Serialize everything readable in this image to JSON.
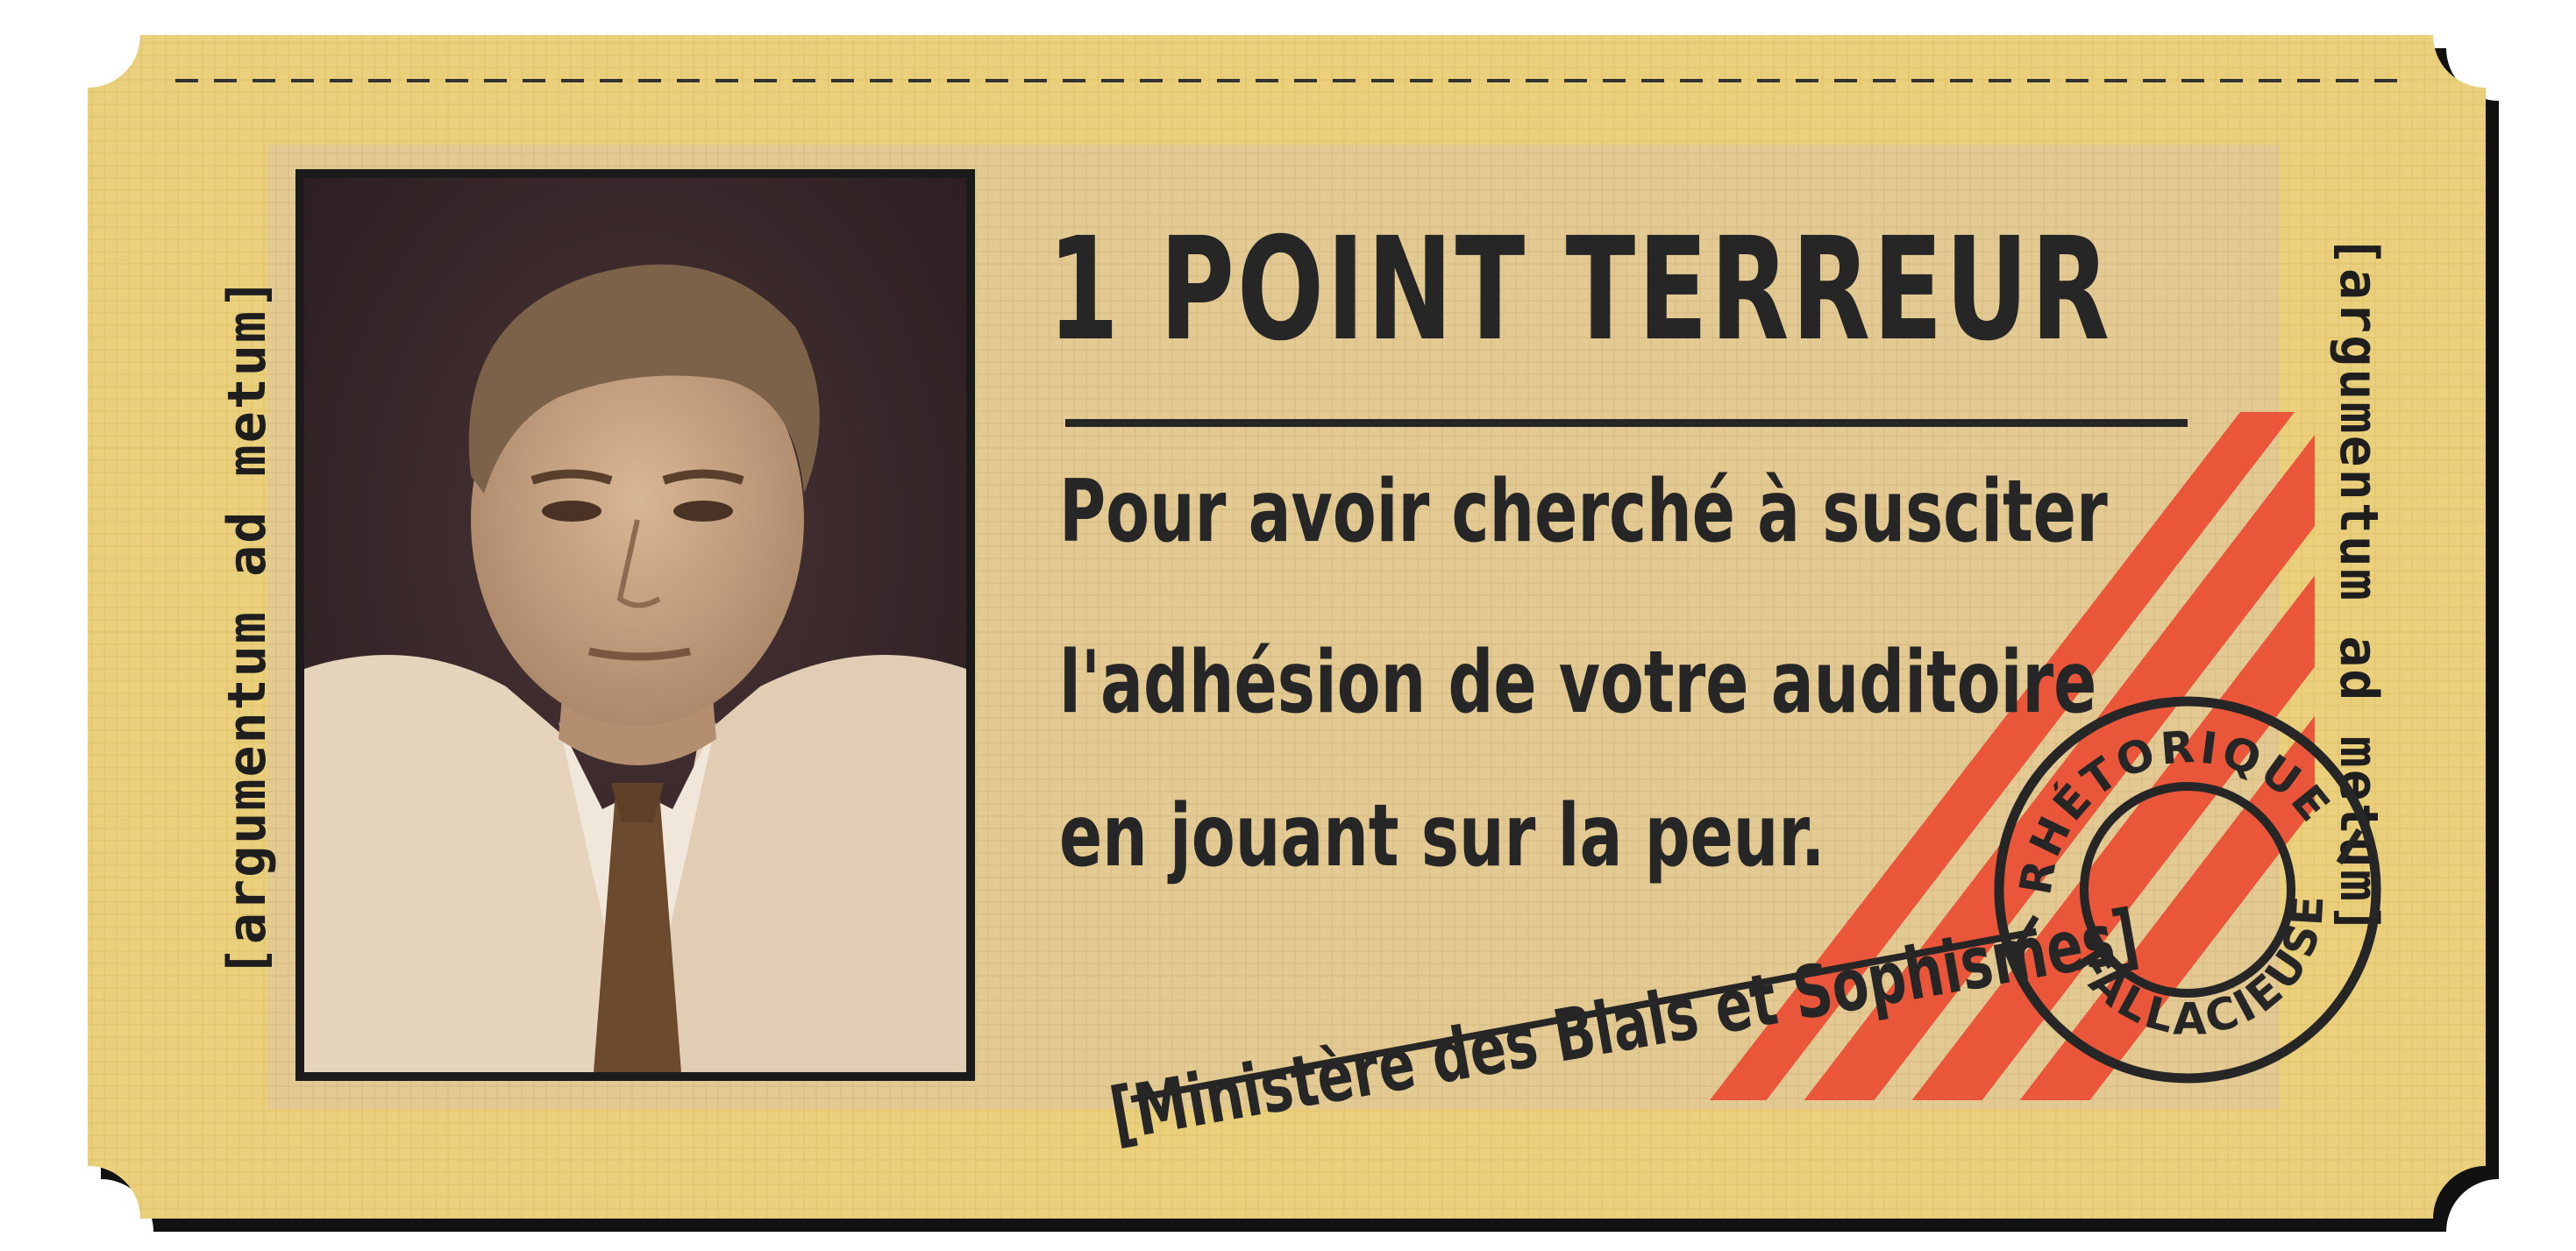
{
  "ticket": {
    "side_text_left": "[argumentum ad metum]",
    "side_text_right": "[argumentum ad metum]",
    "title": "1 POINT TERREUR",
    "body_lines": [
      "Pour avoir cherché à susciter",
      "l'adhésion de votre auditoire",
      "en jouant sur la peur."
    ],
    "signature": "[Ministère des Biais et Sophismes]",
    "stamp": {
      "top_text": "RHÉTORIQUE",
      "bottom_text": "FALLACIEUSE"
    }
  },
  "colors": {
    "ticket_bg": "#ead07c",
    "panel_bg": "#e2c890",
    "ink": "#262626",
    "stripe": "#e9563a",
    "photo_sepia": "#c9ab86"
  },
  "icons": [
    "portrait-photo",
    "stamp-seal",
    "diagonal-stripes"
  ]
}
